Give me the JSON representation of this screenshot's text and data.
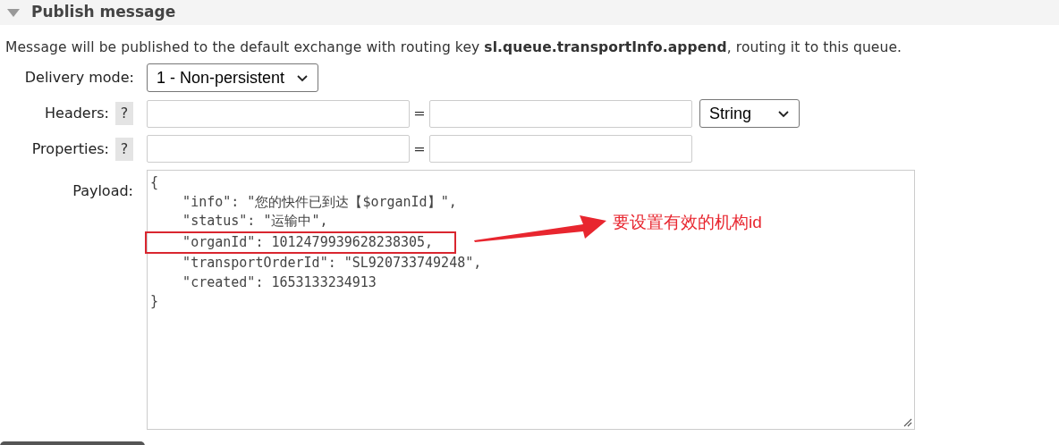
{
  "section": {
    "title": "Publish message",
    "expanded": true
  },
  "description": "Message will be published to the default exchange with routing key **sl.queue.transportInfo.append**, routing it to this queue.",
  "delivery_mode": {
    "label": "Delivery mode:",
    "value": "1 - Non-persistent"
  },
  "headers": {
    "label": "Headers:",
    "help": "?",
    "equals": "=",
    "type": "String"
  },
  "properties": {
    "label": "Properties:",
    "help": "?",
    "equals": "="
  },
  "payload": {
    "label": "Payload:",
    "lines": [
      {
        "text": "{",
        "highlighted": false
      },
      {
        "text": "    \"info\": \"您的快件已到达【$organId】\",",
        "highlighted": false
      },
      {
        "text": "    \"status\": \"运输中\",",
        "highlighted": false
      },
      {
        "text": "    \"organId\": 1012479939628238305,",
        "highlighted": true
      },
      {
        "text": "    \"transportOrderId\": \"SL920733749248\",",
        "highlighted": false
      },
      {
        "text": "    \"created\": 1653133234913",
        "highlighted": false
      },
      {
        "text": "}",
        "highlighted": false
      }
    ]
  },
  "annotation": {
    "text": "要设置有效的机构id"
  }
}
